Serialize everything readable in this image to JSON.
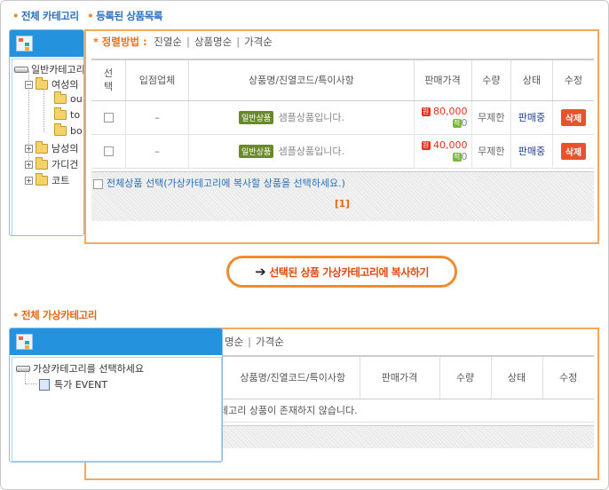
{
  "sections": {
    "all_category": {
      "prefix": "전체 카테고리",
      "title": "등록된 상품목록"
    },
    "virtual_category": {
      "title": "전체 가상카테고리"
    }
  },
  "sort": {
    "star": "*",
    "label": "정렬방법 :",
    "options": [
      "진열순",
      "상품명순",
      "가격순"
    ],
    "separator": "|"
  },
  "product_table": {
    "headers": [
      "선택",
      "입점업체",
      "상품명/진열코드/특이사항",
      "판매가격",
      "수량",
      "상태",
      "수정"
    ],
    "rows": [
      {
        "vendor": "–",
        "badge": "일반상품",
        "name": "샘플상품입니다.",
        "price": "80,000",
        "point": "0",
        "quantity": "무제한",
        "status": "판매중",
        "action": "삭제"
      },
      {
        "vendor": "–",
        "badge": "일반상품",
        "name": "샘플상품입니다.",
        "price": "40,000",
        "point": "0",
        "quantity": "무제한",
        "status": "판매중",
        "action": "삭제"
      }
    ],
    "select_all_label": "전체상품 선택(가상카테고리에 복사할 상품을 선택하세요.)",
    "pager": "[1]"
  },
  "icons": {
    "won": "원",
    "point": "적"
  },
  "copy_button": {
    "arrow": "➔",
    "label": "선택된 상품 가상카테고리에 복사하기"
  },
  "category_tree": {
    "root": "일반카테고리",
    "items": [
      "여성의",
      "ou",
      "to",
      "bo",
      "남성의",
      "가디건",
      "코트"
    ]
  },
  "virtual_sort_visible": {
    "options": [
      "명순",
      "가격순"
    ],
    "separator": "|"
  },
  "virtual_table": {
    "headers": [
      "상품명/진열코드/특이사항",
      "판매가격",
      "수량",
      "상태",
      "수정"
    ],
    "empty_message": "테고리 상품이 존재하지 않습니다."
  },
  "virtual_tree": {
    "root": "가상카테고리를 선택하세요",
    "items": [
      "특가 EVENT"
    ]
  },
  "colors": {
    "accent_orange": "#f7a95b",
    "title_blue": "#2a6fb8",
    "tree_header": "#2492dc",
    "delete_red": "#e8532c"
  }
}
